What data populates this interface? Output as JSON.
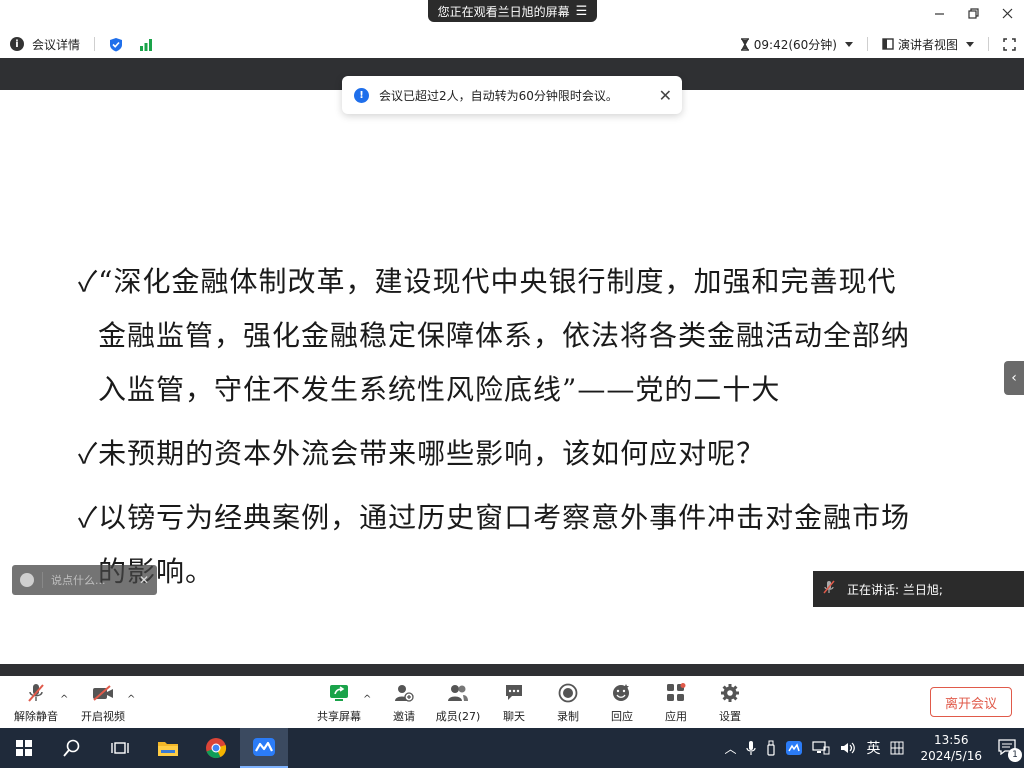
{
  "titlebar": {
    "share_banner": "您正在观看兰日旭的屏幕",
    "share_menu_glyph": "☰"
  },
  "meetbar": {
    "meeting_info": "会议详情",
    "timer": "09:42(60分钟)",
    "view_mode": "演讲者视图"
  },
  "toast": {
    "message": "会议已超过2人，自动转为60分钟限时会议。"
  },
  "slide": {
    "lines": [
      "✓“深化金融体制改革，建设现代中央银行制度，加强和完善现代",
      "金融监管，强化金融稳定保障体系，依法将各类金融活动全部纳",
      "入监管，守住不发生系统性风险底线”——党的二十大",
      "✓未预期的资本外流会带来哪些影响，该如何应对呢？",
      "✓以镑亏为经典案例，通过历史窗口考察意外事件冲击对金融市场",
      "的影响。"
    ]
  },
  "chat": {
    "placeholder": "说点什么..."
  },
  "speaker": {
    "label": "正在讲话:  兰日旭;"
  },
  "controls": {
    "unmute": "解除静音",
    "start_video": "开启视频",
    "share_screen": "共享屏幕",
    "invite": "邀请",
    "members": "成员(27)",
    "chat": "聊天",
    "record": "录制",
    "react": "回应",
    "apps": "应用",
    "settings": "设置",
    "leave": "离开会议"
  },
  "taskbar": {
    "time": "13:56",
    "date": "2024/5/16",
    "ime": "英",
    "notifications": "1"
  },
  "colors": {
    "accent_blue": "#1f6feb",
    "leave_red": "#e05a4a",
    "share_green": "#1aa34a"
  }
}
